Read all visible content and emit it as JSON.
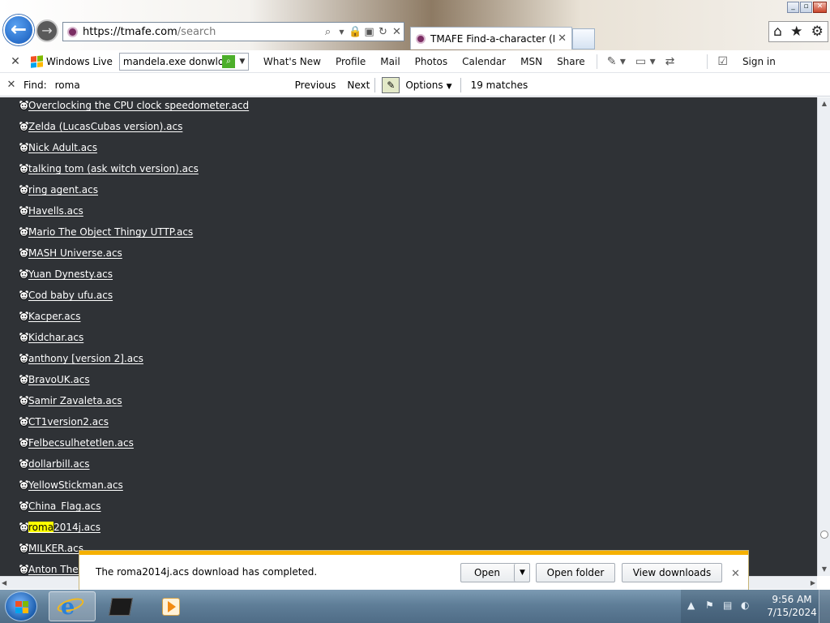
{
  "window_controls": [
    "_",
    "▫",
    "✕"
  ],
  "address": {
    "host": "https://tmafe.com",
    "path": "/search"
  },
  "tab": {
    "title": "TMAFE Find-a-character (B..."
  },
  "command_bar": {
    "close": "✕",
    "brand": "Windows Live",
    "search_query": "mandela.exe donwload",
    "links": [
      "What's New",
      "Profile",
      "Mail",
      "Photos",
      "Calendar",
      "MSN",
      "Share"
    ],
    "sign_in": "Sign in"
  },
  "find_bar": {
    "close": "✕",
    "label": "Find:",
    "query": "roma",
    "previous": "Previous",
    "next": "Next",
    "options": "Options",
    "matches": "19 matches"
  },
  "characters": [
    {
      "name": "Overclocking the CPU clock speedometer.acd"
    },
    {
      "name": "Zelda (LucasCubas version).acs"
    },
    {
      "name": "Nick Adult.acs"
    },
    {
      "name": "talking tom (ask witch version).acs"
    },
    {
      "name": "ring agent.acs"
    },
    {
      "name": "Havells.acs"
    },
    {
      "name": "Mario The Object Thingy UTTP.acs"
    },
    {
      "name": "MASH Universe.acs"
    },
    {
      "name": "Yuan Dynesty.acs"
    },
    {
      "name": "Cod baby ufu.acs"
    },
    {
      "name": "Kacper.acs"
    },
    {
      "name": "Kidchar.acs"
    },
    {
      "name": "anthony [version 2].acs"
    },
    {
      "name": "BravoUK.acs"
    },
    {
      "name": "Samir Zavaleta.acs"
    },
    {
      "name": "CT1version2.acs"
    },
    {
      "name": "Felbecsulhetetlen.acs"
    },
    {
      "name": "dollarbill.acs"
    },
    {
      "name": "YellowStickman.acs"
    },
    {
      "name": "China_Flag.acs"
    },
    {
      "name": "roma2014j.acs",
      "highlight": "roma",
      "rest": "2014j.acs"
    },
    {
      "name": "MILKER.acs"
    },
    {
      "name": "Anton The R"
    }
  ],
  "notification": {
    "message": "The roma2014j.acs download has completed.",
    "open": "Open",
    "open_folder": "Open folder",
    "view_downloads": "View downloads",
    "close": "✕"
  },
  "taskbar": {
    "time": "9:56 AM",
    "date": "7/15/2024"
  },
  "colors": {
    "page_background": "#2f3236",
    "find_highlight": "#ffff00",
    "notification_accent": "#f5b000",
    "taskbar": "#5f7e98"
  }
}
